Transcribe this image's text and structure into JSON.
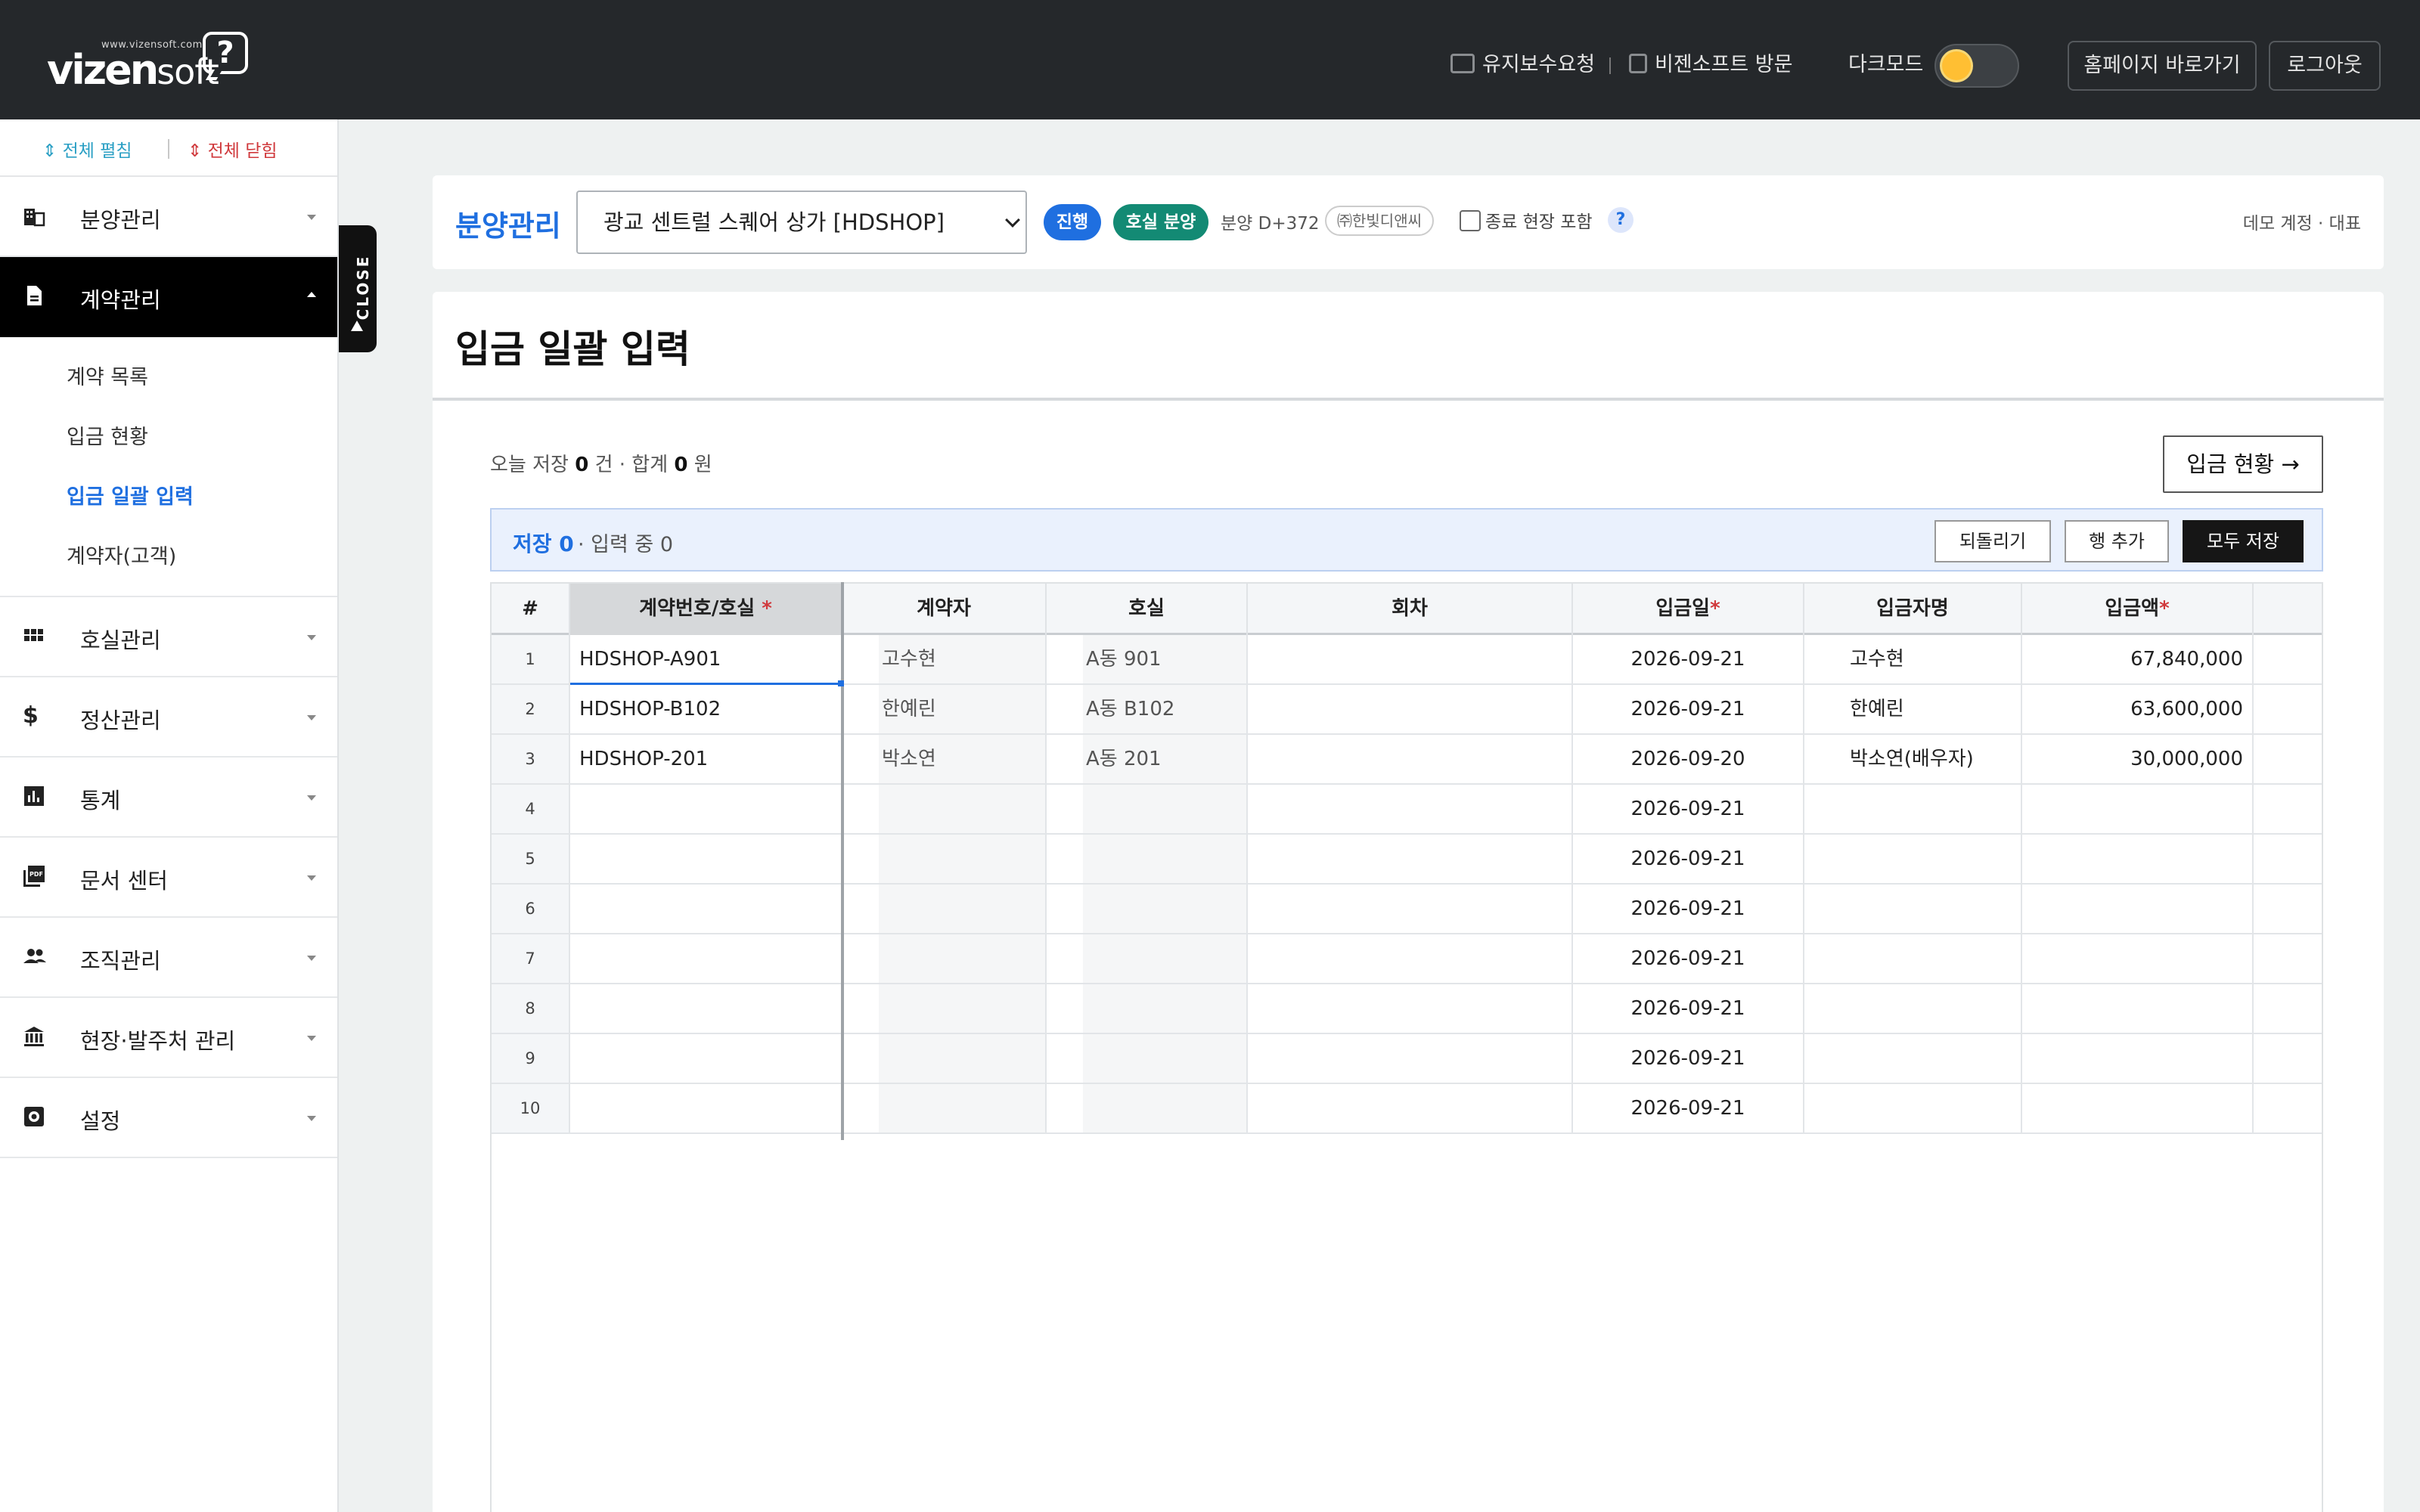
{
  "topbar": {
    "logo_small": "www.vizensoft.com",
    "logo_word": "vizen",
    "logo_soft": "soft",
    "logo_mark": "?",
    "maintenance": "유지보수요청",
    "visit": "비젠소프트 방문",
    "dark_mode": "다크모드",
    "homepage": "홈페이지 바로가기",
    "logout": "로그아웃"
  },
  "sidebar": {
    "expand_all": "⇕ 전체 펼침",
    "collapse_all": "⇕ 전체 닫힘",
    "close_tab": "CLOSE",
    "items": [
      {
        "label": "분양관리",
        "icon": "building-icon"
      },
      {
        "label": "계약관리",
        "icon": "document-icon"
      },
      {
        "label": "호실관리",
        "icon": "grid-icon"
      },
      {
        "label": "정산관리",
        "icon": "dollar-icon"
      },
      {
        "label": "통계",
        "icon": "bar-chart-icon"
      },
      {
        "label": "문서 센터",
        "icon": "pdf-icon"
      },
      {
        "label": "조직관리",
        "icon": "people-icon"
      },
      {
        "label": "현장·발주처 관리",
        "icon": "bank-icon"
      },
      {
        "label": "설정",
        "icon": "gear-icon"
      }
    ],
    "submenu": [
      "계약 목록",
      "입금 현황",
      "입금 일괄 입력",
      "계약자(고객)"
    ]
  },
  "sitebar": {
    "title": "분양관리",
    "select_value": "광교 센트럴 스퀘어 상가 [HDSHOP]",
    "badge_progress": "진행",
    "badge_type": "호실 분양",
    "dday": "분양 D+372",
    "company": "㈜한빛디앤씨",
    "include_closed": "종료 현장 포함",
    "help": "?",
    "account": "데모 계정 · 대표"
  },
  "panel": {
    "title": "입금 일괄 입력",
    "today_prefix": "오늘 저장",
    "today_count": "0",
    "today_mid": "건 · 합계",
    "today_sum": "0",
    "today_suffix": "원",
    "status_button": "입금 현황 →",
    "saved": "저장 0",
    "in_progress": "· 입력 중 0",
    "undo": "되돌리기",
    "add_row": "행 추가",
    "save_all": "모두 저장"
  },
  "grid": {
    "headers": {
      "rownum": "#",
      "contract": "계약번호/호실",
      "contractor": "계약자",
      "unit": "호실",
      "round": "회차",
      "date": "입금일",
      "payer": "입금자명",
      "amount": "입금액",
      "req": "*"
    },
    "rows": [
      {
        "n": "1",
        "contract": "HDSHOP-A901",
        "contractor": "고수현",
        "unit": "A동 901",
        "round": "",
        "date": "2026-09-21",
        "payer": "고수현",
        "amount": "67,840,000"
      },
      {
        "n": "2",
        "contract": "HDSHOP-B102",
        "contractor": "한예린",
        "unit": "A동 B102",
        "round": "",
        "date": "2026-09-21",
        "payer": "한예린",
        "amount": "63,600,000"
      },
      {
        "n": "3",
        "contract": "HDSHOP-201",
        "contractor": "박소연",
        "unit": "A동 201",
        "round": "",
        "date": "2026-09-20",
        "payer": "박소연(배우자)",
        "amount": "30,000,000"
      },
      {
        "n": "4",
        "contract": "",
        "contractor": "",
        "unit": "",
        "round": "",
        "date": "2026-09-21",
        "payer": "",
        "amount": ""
      },
      {
        "n": "5",
        "contract": "",
        "contractor": "",
        "unit": "",
        "round": "",
        "date": "2026-09-21",
        "payer": "",
        "amount": ""
      },
      {
        "n": "6",
        "contract": "",
        "contractor": "",
        "unit": "",
        "round": "",
        "date": "2026-09-21",
        "payer": "",
        "amount": ""
      },
      {
        "n": "7",
        "contract": "",
        "contractor": "",
        "unit": "",
        "round": "",
        "date": "2026-09-21",
        "payer": "",
        "amount": ""
      },
      {
        "n": "8",
        "contract": "",
        "contractor": "",
        "unit": "",
        "round": "",
        "date": "2026-09-21",
        "payer": "",
        "amount": ""
      },
      {
        "n": "9",
        "contract": "",
        "contractor": "",
        "unit": "",
        "round": "",
        "date": "2026-09-21",
        "payer": "",
        "amount": ""
      },
      {
        "n": "10",
        "contract": "",
        "contractor": "",
        "unit": "",
        "round": "",
        "date": "2026-09-21",
        "payer": "",
        "amount": ""
      }
    ]
  },
  "colors": {
    "accent": "#1f6fe0",
    "topbar": "#25282b",
    "badge_progress": "#1f6fe0",
    "badge_type": "#138a74",
    "required": "#d0393c"
  }
}
